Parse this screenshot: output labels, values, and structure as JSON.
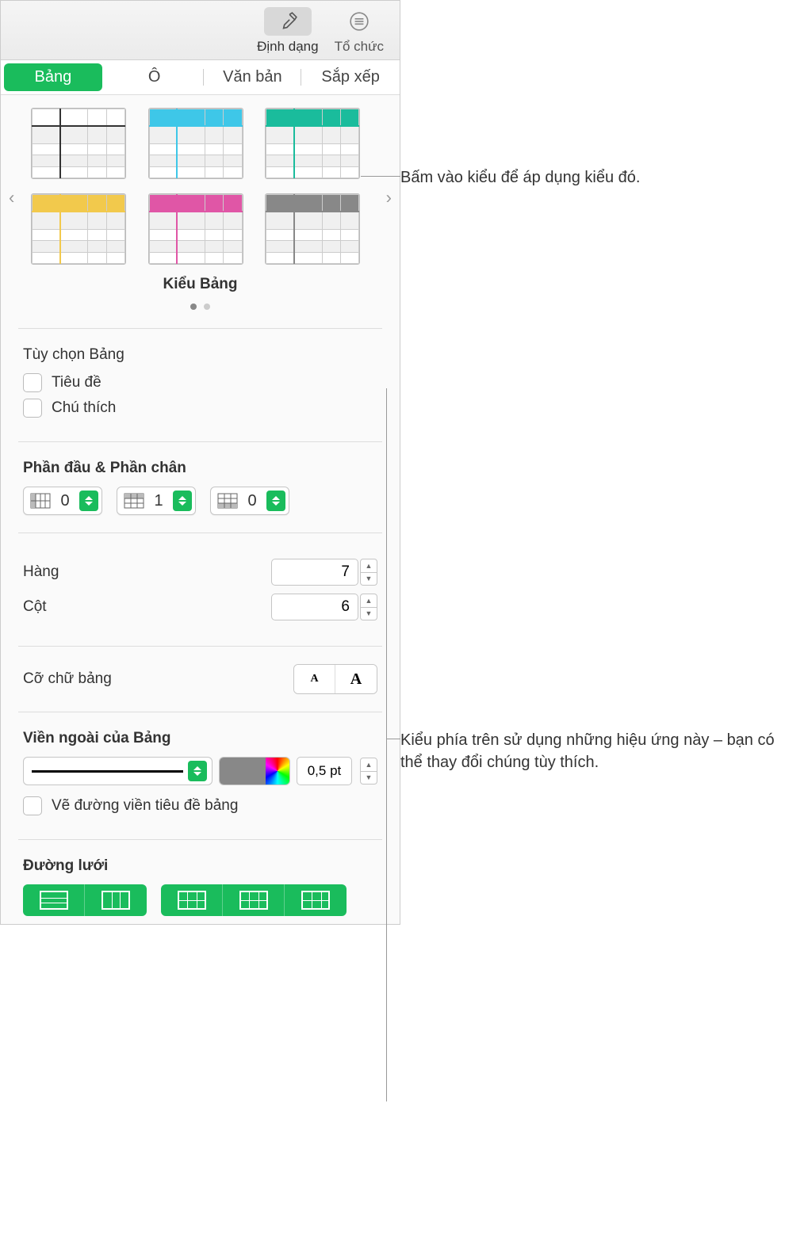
{
  "toolbar": {
    "format_label": "Định dạng",
    "organize_label": "Tổ chức"
  },
  "tabs": {
    "table": "Bảng",
    "cell": "Ô",
    "text": "Văn bản",
    "arrange": "Sắp xếp"
  },
  "styles": {
    "title": "Kiểu Bảng",
    "thumbnails": [
      {
        "accent": "#333333"
      },
      {
        "accent": "#3ec7e8",
        "header_bg": "#3ec7e8"
      },
      {
        "accent": "#1abc9c",
        "header_bg": "#1abc9c"
      },
      {
        "accent": "#f2c94c",
        "header_bg": "#f2c94c"
      },
      {
        "accent": "#e056a6",
        "header_bg": "#e056a6"
      },
      {
        "accent": "#888888",
        "header_bg": "#888888"
      }
    ]
  },
  "options": {
    "section_title": "Tùy chọn Bảng",
    "title_label": "Tiêu đề",
    "caption_label": "Chú thích"
  },
  "headers_footers": {
    "section_title": "Phần đầu & Phần chân",
    "header_cols": "0",
    "header_rows": "1",
    "footer_rows": "0"
  },
  "rows_cols": {
    "rows_label": "Hàng",
    "rows_value": "7",
    "cols_label": "Cột",
    "cols_value": "6"
  },
  "font_size": {
    "label": "Cỡ chữ bảng",
    "small": "A",
    "large": "A"
  },
  "outline": {
    "section_title": "Viền ngoài của Bảng",
    "width_value": "0,5 pt",
    "title_border_label": "Vẽ đường viền tiêu đề bảng",
    "color": "#888888"
  },
  "gridlines": {
    "section_title": "Đường lưới"
  },
  "callouts": {
    "style_click": "Bấm vào kiểu để áp dụng kiểu đó.",
    "effects": "Kiểu phía trên sử dụng những hiệu ứng này – bạn có thể thay đổi chúng tùy thích."
  }
}
